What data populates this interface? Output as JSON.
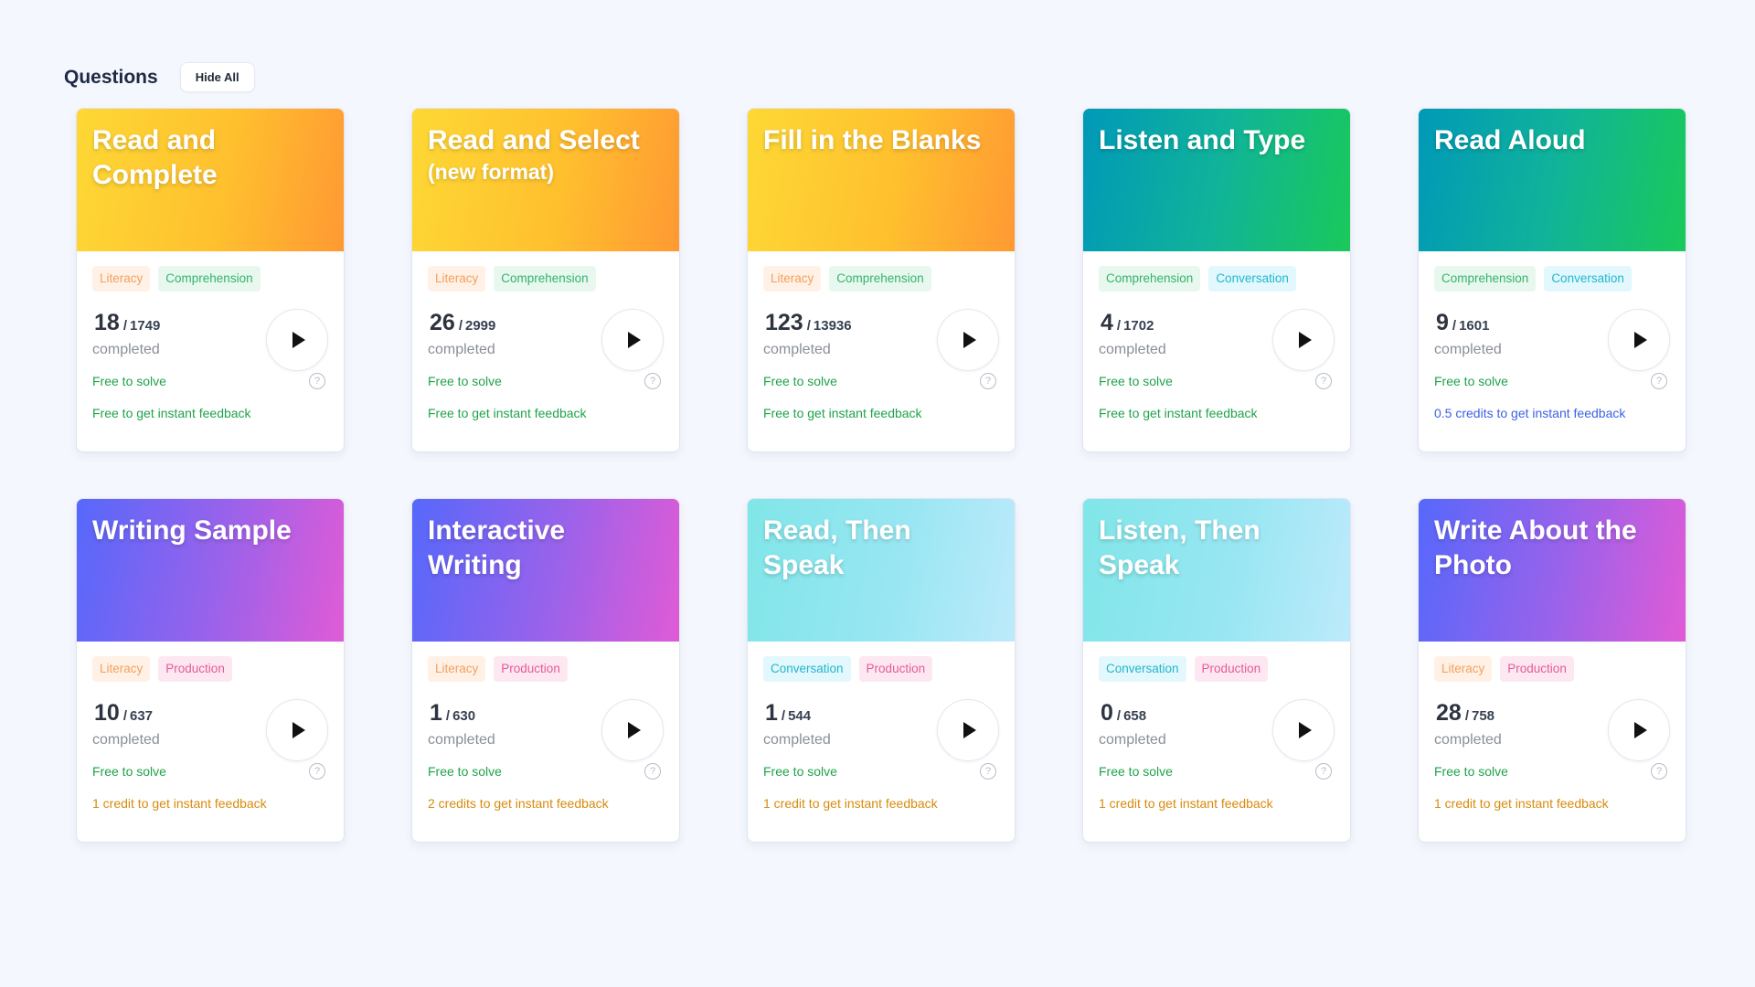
{
  "header": {
    "title": "Questions",
    "hide_label": "Hide All"
  },
  "completed_label": "completed",
  "cards": [
    {
      "title": "Read and Complete",
      "subtitle": "",
      "tags": [
        "Literacy",
        "Comprehension"
      ],
      "done": "18",
      "total": "1749",
      "solve": "Free to solve",
      "feedback": "Free to get instant feedback"
    },
    {
      "title": "Read and Select",
      "subtitle": "(new format)",
      "tags": [
        "Literacy",
        "Comprehension"
      ],
      "done": "26",
      "total": "2999",
      "solve": "Free to solve",
      "feedback": "Free to get instant feedback"
    },
    {
      "title": "Fill in the Blanks",
      "subtitle": "",
      "tags": [
        "Literacy",
        "Comprehension"
      ],
      "done": "123",
      "total": "13936",
      "solve": "Free to solve",
      "feedback": "Free to get instant feedback"
    },
    {
      "title": "Listen and Type",
      "subtitle": "",
      "tags": [
        "Comprehension",
        "Conversation"
      ],
      "done": "4",
      "total": "1702",
      "solve": "Free to solve",
      "feedback": "Free to get instant feedback"
    },
    {
      "title": "Read Aloud",
      "subtitle": "",
      "tags": [
        "Comprehension",
        "Conversation"
      ],
      "done": "9",
      "total": "1601",
      "solve": "Free to solve",
      "feedback": "0.5 credits to get instant feedback"
    },
    {
      "title": "Writing Sample",
      "subtitle": "",
      "tags": [
        "Literacy",
        "Production"
      ],
      "done": "10",
      "total": "637",
      "solve": "Free to solve",
      "feedback": "1 credit to get instant feedback"
    },
    {
      "title": "Interactive Writing",
      "subtitle": "",
      "tags": [
        "Literacy",
        "Production"
      ],
      "done": "1",
      "total": "630",
      "solve": "Free to solve",
      "feedback": "2 credits to get instant feedback"
    },
    {
      "title": "Read, Then Speak",
      "subtitle": "",
      "tags": [
        "Conversation",
        "Production"
      ],
      "done": "1",
      "total": "544",
      "solve": "Free to solve",
      "feedback": "1 credit to get instant feedback"
    },
    {
      "title": "Listen, Then Speak",
      "subtitle": "",
      "tags": [
        "Conversation",
        "Production"
      ],
      "done": "0",
      "total": "658",
      "solve": "Free to solve",
      "feedback": "1 credit to get instant feedback"
    },
    {
      "title": "Write About the Photo",
      "subtitle": "",
      "tags": [
        "Literacy",
        "Production"
      ],
      "done": "28",
      "total": "758",
      "solve": "Free to solve",
      "feedback": "1 credit to get instant feedback"
    }
  ],
  "colors": {
    "background": "#f4f7fd",
    "free_green": "#1fa34a",
    "credit_orange": "#d98a0b",
    "credit_blue": "#3b63e6"
  }
}
